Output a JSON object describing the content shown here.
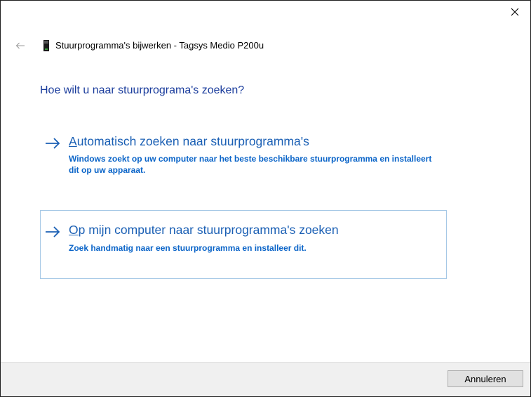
{
  "window": {
    "title": "Stuurprogramma's bijwerken - Tagsys Medio P200u",
    "close_icon": "close-icon",
    "back_icon": "back-arrow-icon",
    "device_icon": "usb-device-icon"
  },
  "main": {
    "heading": "Hoe wilt u naar stuurprograma's zoeken?",
    "options": [
      {
        "accesskey": "A",
        "title_rest": "utomatisch zoeken naar stuurprogramma's",
        "description": "Windows zoekt op uw computer naar het beste beschikbare stuurprogramma en installeert dit op uw apparaat.",
        "icon": "arrow-right-icon"
      },
      {
        "accesskey": "O",
        "title_rest": "p mijn computer naar stuurprogramma's zoeken",
        "description": "Zoek handmatig naar een stuurprogramma en installeer dit.",
        "icon": "arrow-right-icon"
      }
    ]
  },
  "footer": {
    "cancel_label": "Annuleren"
  },
  "colors": {
    "heading": "#1a3c9c",
    "link": "#1a5fb4",
    "description": "#0a64c8",
    "focus_border": "#a6c8e6",
    "footer_bg": "#f0f0f0"
  }
}
